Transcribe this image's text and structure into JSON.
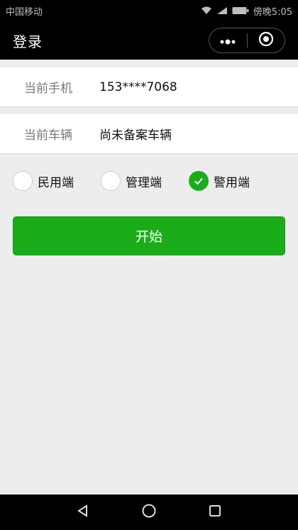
{
  "status_bar": {
    "carrier": "中国移动",
    "time": "傍晚5:05",
    "icons": [
      "wifi-icon",
      "signal-icon",
      "battery-icon"
    ]
  },
  "nav": {
    "title": "登录",
    "menu_icon": "more-dots-icon",
    "close_icon": "close-target-icon"
  },
  "form": {
    "phone": {
      "label": "当前手机",
      "value": "153****7068"
    },
    "vehicle": {
      "label": "当前车辆",
      "value": "尚未备案车辆"
    }
  },
  "role_options": [
    {
      "label": "民用端",
      "checked": false
    },
    {
      "label": "管理端",
      "checked": false
    },
    {
      "label": "警用端",
      "checked": true
    }
  ],
  "start_button": {
    "label": "开始"
  },
  "colors": {
    "accent": "#1aad19",
    "background": "#ededed",
    "bar": "#000000"
  },
  "bottom_nav": [
    "back-icon",
    "home-icon",
    "recent-apps-icon"
  ]
}
